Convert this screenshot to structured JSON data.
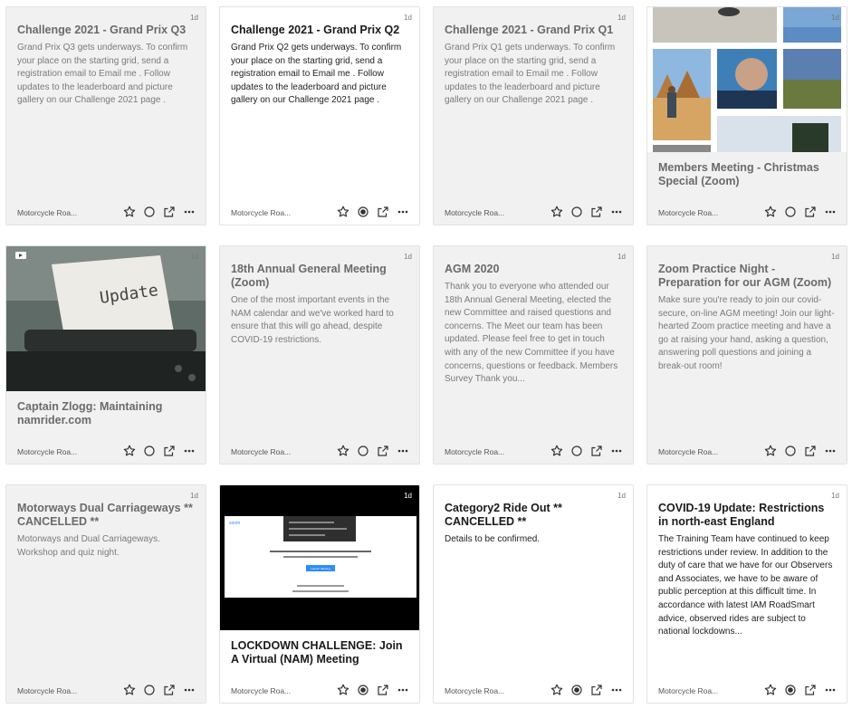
{
  "cards": [
    {
      "title": "Challenge 2021 - Grand Prix Q3",
      "body": "Grand Prix Q3 gets underways. To confirm your place on the starting grid, send a registration email to Email me . Follow updates to the leaderboard and picture gallery on our Challenge 2021 page .",
      "age": "1d",
      "source": "Motorcycle Roa...",
      "read": true
    },
    {
      "title": "Challenge 2021 - Grand Prix Q2",
      "body": "Grand Prix Q2 gets underways. To confirm your place on the starting grid, send a registration email to Email me . Follow updates to the leaderboard and picture gallery on our Challenge 2021 page .",
      "age": "1d",
      "source": "Motorcycle Roa...",
      "read": false
    },
    {
      "title": "Challenge 2021 - Grand Prix Q1",
      "body": "Grand Prix Q1 gets underways. To confirm your place on the starting grid, send a registration email to Email me . Follow updates to the leaderboard and picture gallery on our Challenge 2021 page .",
      "age": "1d",
      "source": "Motorcycle Roa...",
      "read": true
    },
    {
      "title": "Members Meeting - Christmas Special (Zoom)",
      "body": "",
      "age": "1d",
      "source": "Motorcycle Roa...",
      "read": true
    },
    {
      "title": "Captain Zlogg: Maintaining namrider.com",
      "body": "",
      "age": "1d",
      "source": "Motorcycle Roa...",
      "read": true,
      "thumb_word": "Update"
    },
    {
      "title": "18th Annual General Meeting (Zoom)",
      "body": "One of the most important events in the NAM calendar and we've worked hard to ensure that this will go ahead, despite COVID-19 restrictions.",
      "age": "1d",
      "source": "Motorcycle Roa...",
      "read": true
    },
    {
      "title": "AGM 2020",
      "body": "Thank you to everyone who attended our 18th Annual General Meeting, elected the new Committee and raised questions and concerns. The Meet our team has been updated. Please feel free to get in touch with any of the new Committee if you have concerns, questions or feedback. Members Survey Thank you...",
      "age": "1d",
      "source": "Motorcycle Roa...",
      "read": true
    },
    {
      "title": "Zoom Practice Night - Preparation for our AGM (Zoom)",
      "body": "Make sure you're ready to join our covid-secure, on-line AGM meeting! Join our light-hearted Zoom practice meeting and have a go at raising your hand, asking a question, answering poll questions and joining a break-out room!",
      "age": "1d",
      "source": "Motorcycle Roa...",
      "read": true
    },
    {
      "title": "Motorways Dual Carriageways ** CANCELLED **",
      "body": "Motorways and Dual Carriageways. Workshop and quiz night.",
      "age": "1d",
      "source": "Motorcycle Roa...",
      "read": true
    },
    {
      "title": "LOCKDOWN CHALLENGE: Join A Virtual (NAM) Meeting",
      "body": "",
      "age": "1d",
      "source": "Motorcycle Roa...",
      "read": false,
      "thumb_logo": "zoom",
      "thumb_button": "Launch Meeting"
    },
    {
      "title": "Category2 Ride Out ** CANCELLED **",
      "body": "Details to be confirmed.",
      "age": "1d",
      "source": "Motorcycle Roa...",
      "read": false
    },
    {
      "title": "COVID-19 Update: Restrictions in north-east England",
      "body": "The Training Team have continued to keep restrictions under review. In addition to the duty of care that we have for our Observers and Associates, we have to be aware of public perception at this difficult time. In accordance with latest IAM RoadSmart advice, observed rides are subject to national lockdowns...",
      "age": "1d",
      "source": "Motorcycle Roa...",
      "read": false
    }
  ],
  "icons": {
    "star": "star-icon",
    "mark": "mark-read-icon",
    "open": "open-external-icon",
    "more": "more-icon"
  }
}
